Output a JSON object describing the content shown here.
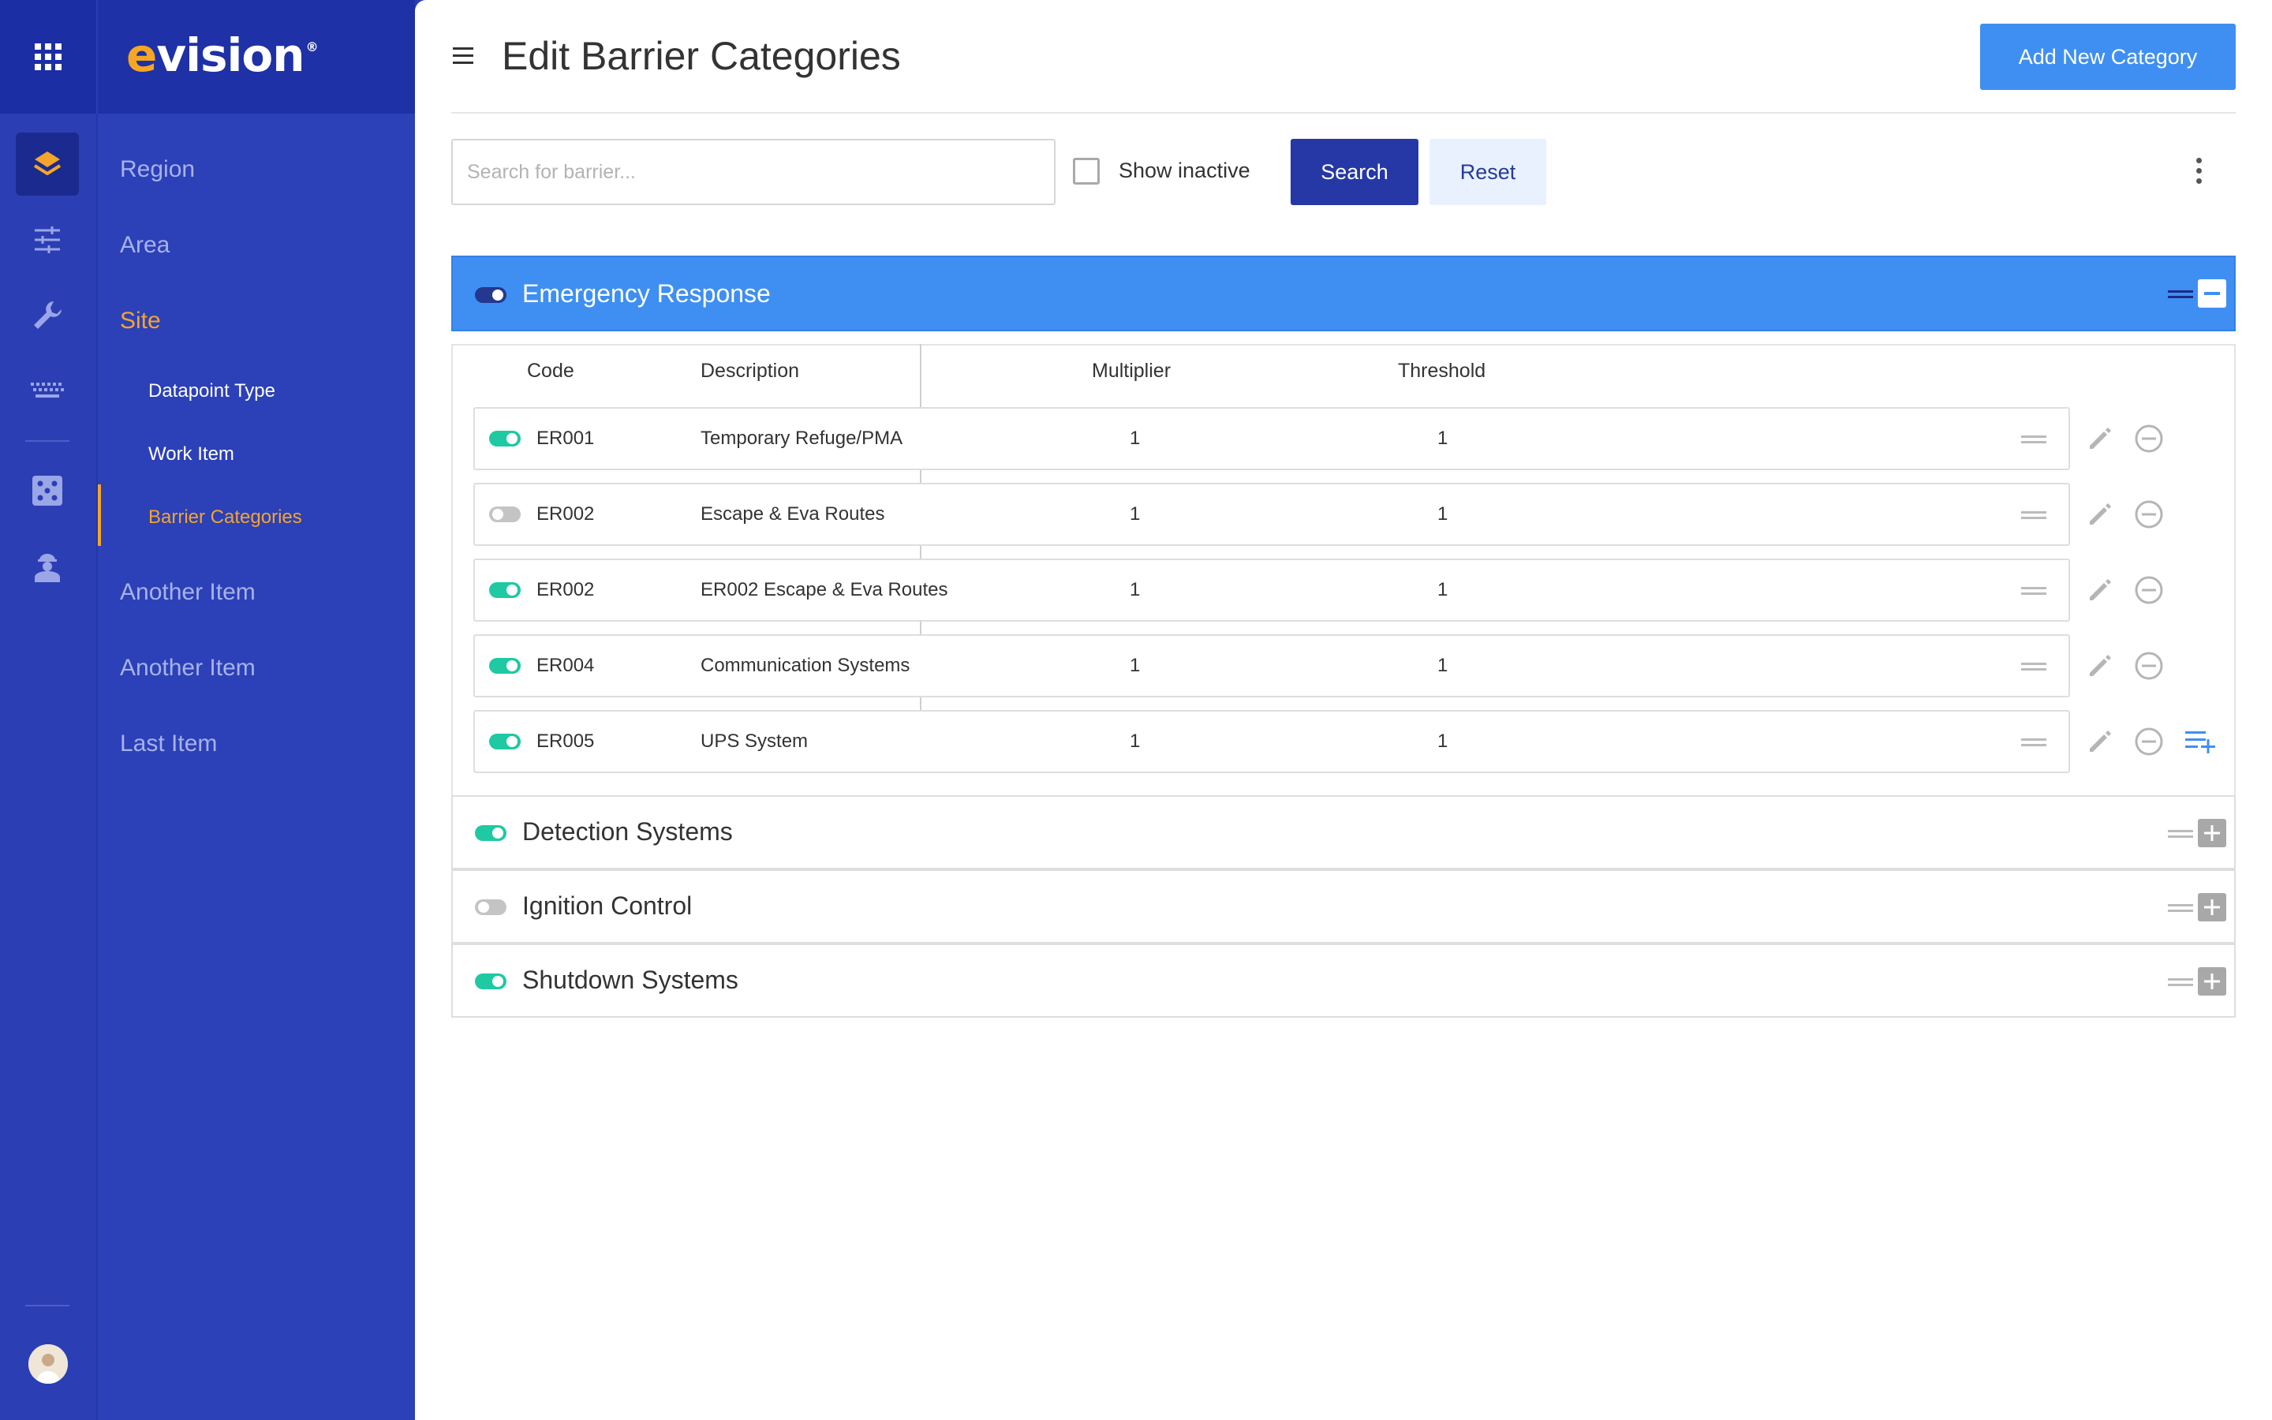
{
  "brand": {
    "logo_prefix": "e",
    "logo_rest": "vision",
    "logo_mark": "®"
  },
  "rail": {
    "icons": [
      "apps-grid-icon",
      "layers-icon",
      "sliders-icon",
      "wrench-icon",
      "keyboard-icon",
      "dice-icon",
      "worker-icon"
    ]
  },
  "nav": {
    "items": [
      {
        "label": "Region"
      },
      {
        "label": "Area"
      },
      {
        "label": "Site"
      },
      {
        "label": "Another Item"
      },
      {
        "label": "Another Item"
      },
      {
        "label": "Last Item"
      }
    ],
    "sub_items": [
      {
        "label": "Datapoint Type"
      },
      {
        "label": "Work Item"
      },
      {
        "label": "Barrier Categories"
      }
    ]
  },
  "header": {
    "title": "Edit Barrier Categories",
    "add_button": "Add New Category"
  },
  "toolbar": {
    "search_placeholder": "Search for barrier...",
    "show_inactive_label": "Show inactive",
    "show_inactive_checked": false,
    "search_button": "Search",
    "reset_button": "Reset"
  },
  "table": {
    "columns": {
      "code": "Code",
      "description": "Description",
      "multiplier": "Multiplier",
      "threshold": "Threshold"
    }
  },
  "categories": [
    {
      "title": "Emergency Response",
      "active": true,
      "expanded": true,
      "rows": [
        {
          "code": "ER001",
          "description": "Temporary Refuge/PMA",
          "multiplier": "1",
          "threshold": "1",
          "active": true
        },
        {
          "code": "ER002",
          "description": "Escape & Eva Routes",
          "multiplier": "1",
          "threshold": "1",
          "active": false
        },
        {
          "code": "ER002",
          "description": "ER002 Escape & Eva Routes",
          "multiplier": "1",
          "threshold": "1",
          "active": true
        },
        {
          "code": "ER004",
          "description": "Communication Systems",
          "multiplier": "1",
          "threshold": "1",
          "active": true
        },
        {
          "code": "ER005",
          "description": "UPS System",
          "multiplier": "1",
          "threshold": "1",
          "active": true
        }
      ]
    },
    {
      "title": "Detection Systems",
      "active": true,
      "expanded": false
    },
    {
      "title": "Ignition Control",
      "active": false,
      "expanded": false
    },
    {
      "title": "Shutdown Systems",
      "active": true,
      "expanded": false
    }
  ],
  "colors": {
    "primary_blue": "#3f8ff2",
    "dark_blue": "#2538a6",
    "sidebar_blue": "#2c40b8",
    "accent_orange": "#f4a52a",
    "toggle_on": "#1fc9a2"
  }
}
